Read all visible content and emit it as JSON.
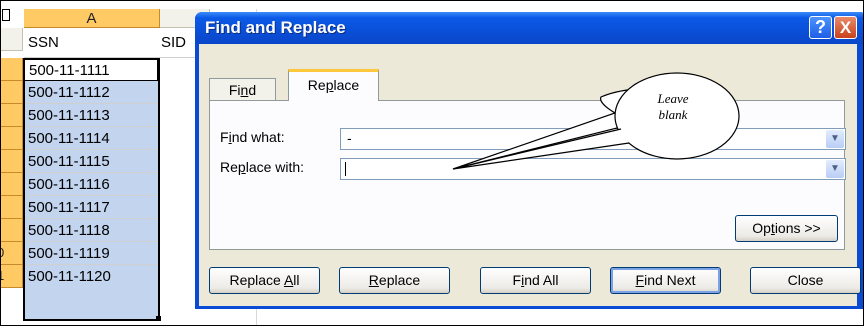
{
  "spreadsheet": {
    "column_a_header": "A",
    "column_a_heading": "SSN",
    "column_b_partial": "SID",
    "row_numbers": [
      "",
      "",
      "",
      "",
      "",
      "",
      "",
      "",
      "0",
      "1"
    ],
    "ssn_values": [
      "500-11-1111",
      "500-11-1112",
      "500-11-1113",
      "500-11-1114",
      "500-11-1115",
      "500-11-1116",
      "500-11-1117",
      "500-11-1118",
      "500-11-1119",
      "500-11-1120"
    ]
  },
  "dialog": {
    "title": "Find and Replace",
    "help_glyph": "?",
    "close_glyph": "X",
    "tabs": {
      "find": {
        "pre": "Fi",
        "key": "n",
        "post": "d"
      },
      "replace": {
        "pre": "Re",
        "key": "p",
        "post": "lace"
      }
    },
    "find_what": {
      "pre": "F",
      "key": "i",
      "post": "nd what:",
      "value": "-"
    },
    "replace_with": {
      "pre": "Re",
      "key": "p",
      "post": "lace with:",
      "value": ""
    },
    "options_button": {
      "pre": "Op",
      "key": "t",
      "post": "ions >>"
    },
    "buttons": {
      "replace_all": {
        "pre": "Replace ",
        "key": "A",
        "post": "ll"
      },
      "replace": {
        "pre": "",
        "key": "R",
        "post": "eplace"
      },
      "find_all": {
        "pre": "F",
        "key": "i",
        "post": "nd All"
      },
      "find_next": {
        "pre": "",
        "key": "F",
        "post": "ind Next"
      },
      "close": "Close"
    }
  },
  "annotation": {
    "line1": "Leave",
    "line2": "blank"
  },
  "colors": {
    "title_bar": "#0a4fd8",
    "selection": "#c2d4ee",
    "header_highlight": "#ffca64",
    "tab_accent": "#ffc83c"
  }
}
